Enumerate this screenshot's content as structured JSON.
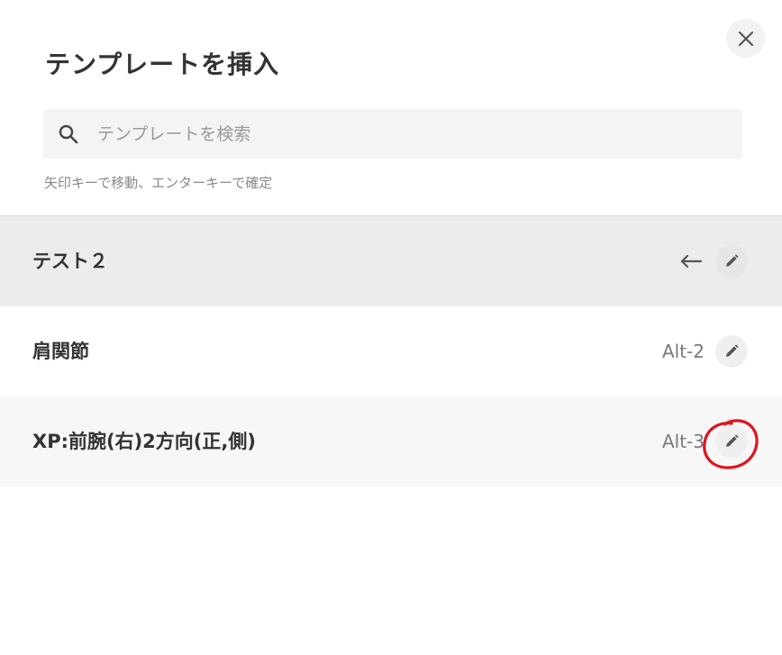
{
  "dialog": {
    "title": "テンプレートを挿入",
    "close_icon": "close-icon"
  },
  "search": {
    "placeholder": "テンプレートを検索",
    "value": "",
    "icon": "search-icon"
  },
  "hint": "矢印キーで移動、エンターキーで確定",
  "templates": [
    {
      "name": "テスト２",
      "shortcut": "",
      "selected": true,
      "right_icon": "enter-arrow-icon",
      "edit_icon": "pencil-icon"
    },
    {
      "name": "肩関節",
      "shortcut": "Alt-2",
      "selected": false,
      "edit_icon": "pencil-icon"
    },
    {
      "name": "XP:前腕(右)2方向(正,側)",
      "shortcut": "Alt-3",
      "selected": false,
      "edit_icon": "pencil-icon"
    }
  ],
  "annotation": {
    "type": "red-hand-drawn-circle",
    "color": "#e0141e",
    "target": "edit-button-row-3"
  },
  "colors": {
    "selected_row_bg": "#ececec",
    "alt_row_bg": "#f7f7f7",
    "search_bg": "#f4f4f4",
    "text": "#333333"
  }
}
